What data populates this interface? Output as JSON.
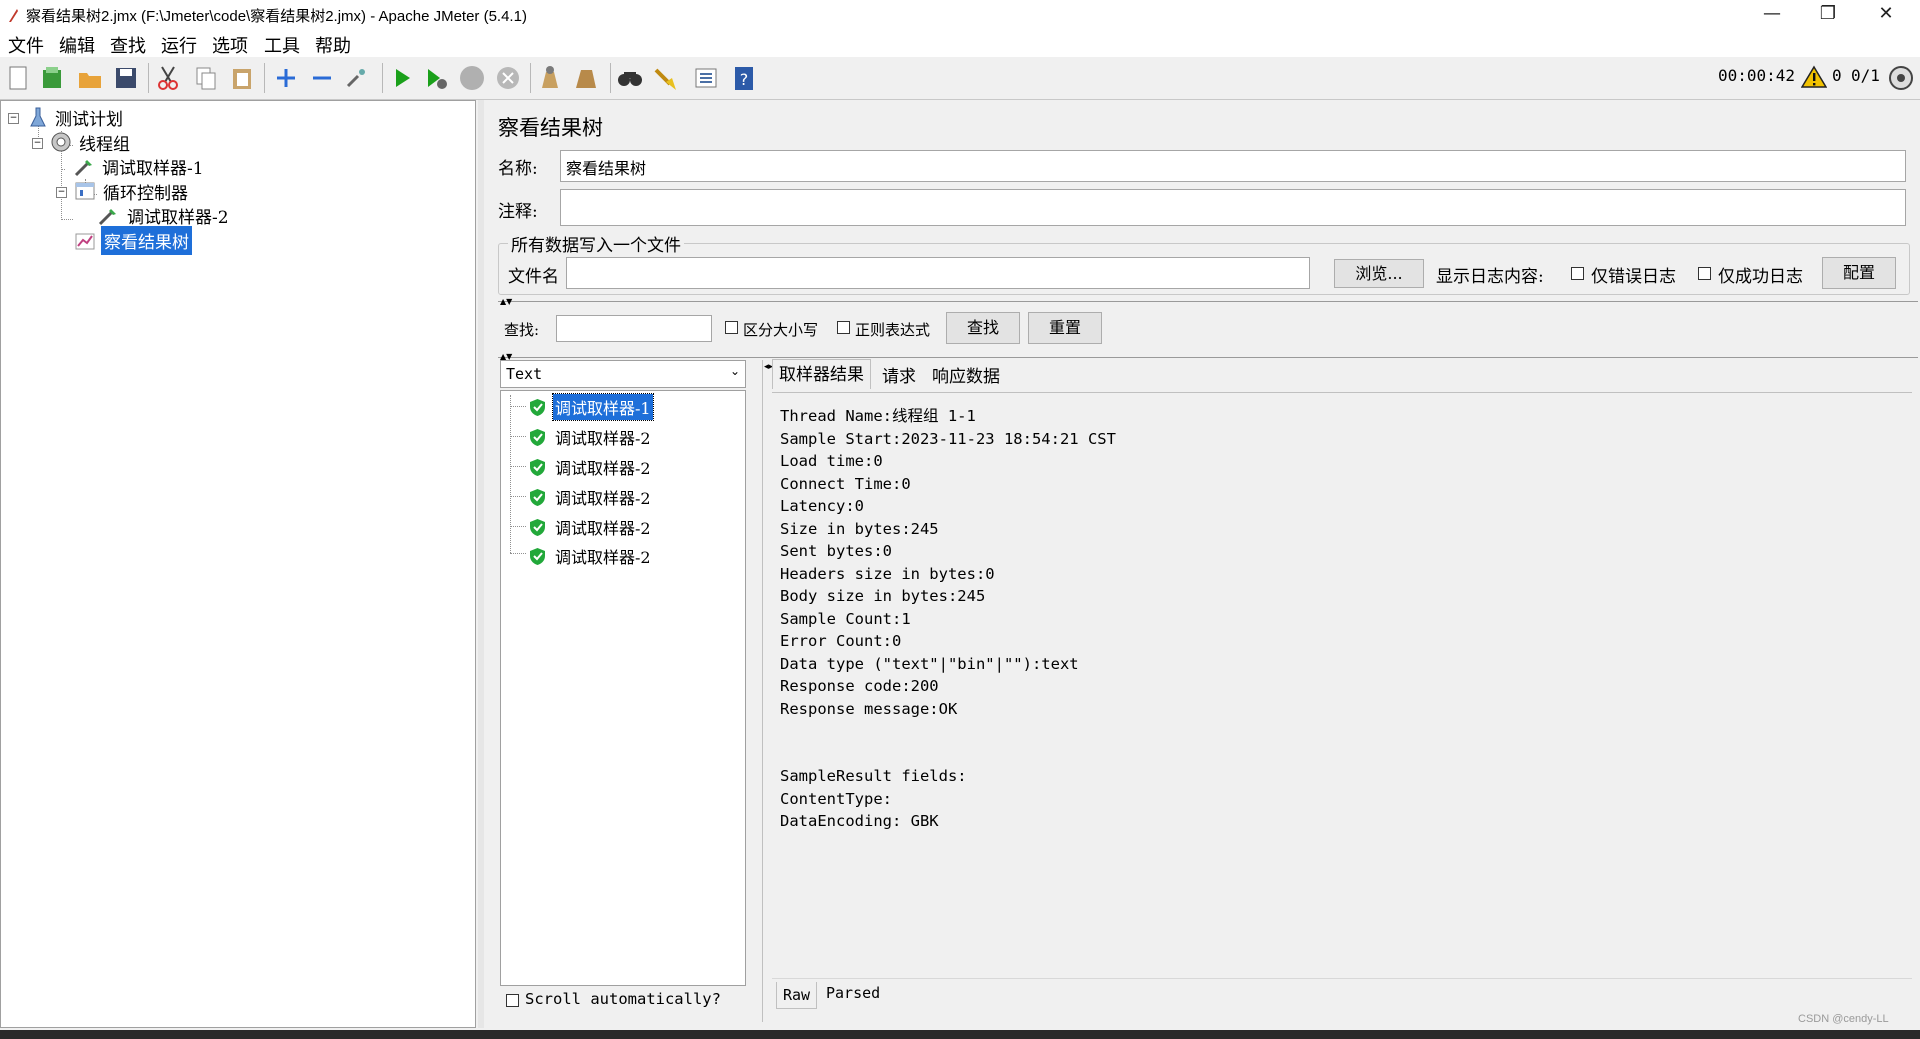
{
  "window": {
    "title": "察看结果树2.jmx (F:\\Jmeter\\code\\察看结果树2.jmx) - Apache JMeter (5.4.1)"
  },
  "menu": [
    "文件",
    "编辑",
    "查找",
    "运行",
    "选项",
    "工具",
    "帮助"
  ],
  "toolbar": {
    "timer": "00:00:42",
    "warning_count": "0",
    "thread_count": "0/1",
    "icons": [
      "new-icon",
      "templates-icon",
      "open-icon",
      "save-icon",
      "cut-icon",
      "copy-icon",
      "paste-icon",
      "expand-icon",
      "collapse-icon",
      "toggle-icon",
      "start-icon",
      "start-no-pause-icon",
      "stop-icon",
      "shutdown-icon",
      "clear-icon",
      "clear-all-icon",
      "search-icon",
      "reset-search-icon",
      "function-helper-icon",
      "help-icon"
    ]
  },
  "tree": {
    "items": [
      {
        "label": "测试计划",
        "icon": "test-plan-icon"
      },
      {
        "label": "线程组",
        "icon": "thread-group-icon"
      },
      {
        "label": "调试取样器-1",
        "icon": "sampler-icon"
      },
      {
        "label": "循环控制器",
        "icon": "loop-controller-icon"
      },
      {
        "label": "调试取样器-2",
        "icon": "sampler-icon"
      },
      {
        "label": "察看结果树",
        "icon": "listener-icon"
      }
    ]
  },
  "panel": {
    "title": "察看结果树",
    "name_label": "名称:",
    "name_value": "察看结果树",
    "comment_label": "注释:",
    "comment_value": "",
    "file_group_label": "所有数据写入一个文件",
    "filename_label": "文件名",
    "filename_value": "",
    "browse_label": "浏览...",
    "log_label": "显示日志内容:",
    "errors_only_label": "仅错误日志",
    "success_only_label": "仅成功日志",
    "configure_label": "配置"
  },
  "search": {
    "label": "查找:",
    "value": "",
    "case_label": "区分大小写",
    "regex_label": "正则表达式",
    "find_button": "查找",
    "reset_button": "重置"
  },
  "results": {
    "renderer": "Text",
    "items": [
      "调试取样器-1",
      "调试取样器-2",
      "调试取样器-2",
      "调试取样器-2",
      "调试取样器-2",
      "调试取样器-2"
    ],
    "scroll_label": "Scroll automatically?"
  },
  "tabs": [
    "取样器结果",
    "请求",
    "响应数据"
  ],
  "detail": {
    "lines": [
      "Thread Name:线程组 1-1",
      "Sample Start:2023-11-23 18:54:21 CST",
      "Load time:0",
      "Connect Time:0",
      "Latency:0",
      "Size in bytes:245",
      "Sent bytes:0",
      "Headers size in bytes:0",
      "Body size in bytes:245",
      "Sample Count:1",
      "Error Count:0",
      "Data type (\"text\"|\"bin\"|\"\"):text",
      "Response code:200",
      "Response message:OK",
      "",
      "",
      "SampleResult fields:",
      "ContentType:",
      "DataEncoding: GBK"
    ]
  },
  "bottom_tabs": [
    "Raw",
    "Parsed"
  ],
  "watermark": "CSDN @cendy-LL"
}
